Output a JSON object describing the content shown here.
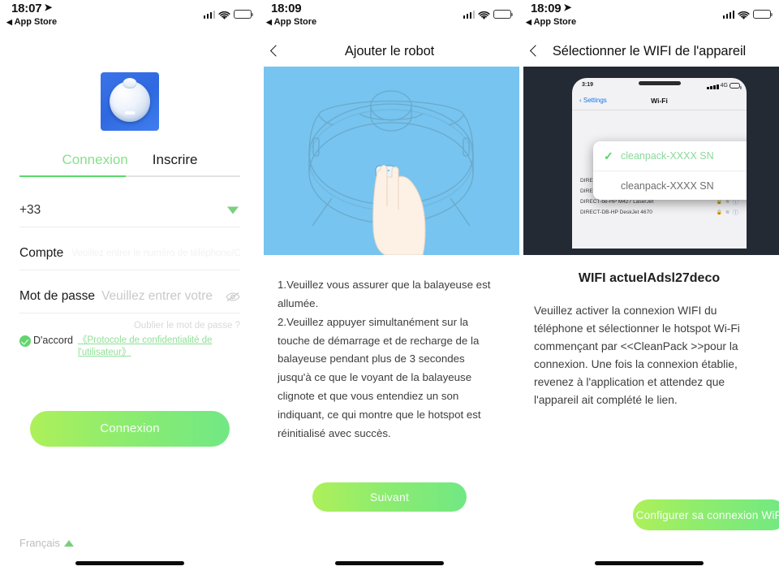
{
  "screens": [
    {
      "status": {
        "time": "18:07",
        "location_icon": "location-arrow-icon",
        "back_label": "App Store",
        "signal": "signal-bars-icon",
        "wifi": "wifi-icon",
        "battery": "battery-icon"
      },
      "logo": {
        "name": "app-logo-robot-vacuum"
      },
      "tabs": [
        {
          "label": "Connexion",
          "active": true
        },
        {
          "label": "Inscrire",
          "active": false
        }
      ],
      "fields": {
        "country_code": {
          "value": "+33",
          "caret": "chevron-down-icon"
        },
        "account": {
          "label": "Compte",
          "placeholder": "Veuillez entrer le numéro de téléphone/Courriel"
        },
        "password": {
          "label": "Mot de passe",
          "placeholder": "Veuillez entrer votre",
          "eye": "eye-off-icon"
        }
      },
      "forgot_label": "Oublier le mot de passe ?",
      "agree": {
        "checked": true,
        "label": "D'accord",
        "link": "《Protocole de confidentialité de l'utilisateur》"
      },
      "submit_label": "Connexion",
      "language": {
        "label": "Français",
        "caret": "chevron-up-icon"
      }
    },
    {
      "status": {
        "time": "18:09",
        "back_label": "App Store"
      },
      "nav": {
        "back": "chevron-left-icon",
        "title": "Ajouter le robot"
      },
      "hero": {
        "name": "robot-vacuum-press-button-illustration",
        "bg": "#76c4ef"
      },
      "instructions": "1.Veuillez vous assurer que la balayeuse est allumée.\n2.Veuillez appuyer simultanément sur la touche de démarrage et de recharge de la balayeuse pendant plus de 3 secondes jusqu'à ce que le voyant de la balayeuse clignote et que vous entendiez un son indiquant, ce qui montre que le hotspot est réinitialisé avec succès.",
      "button_label": "Suivant"
    },
    {
      "status": {
        "time": "18:09",
        "location_icon": "location-arrow-icon",
        "back_label": "App Store"
      },
      "nav": {
        "back": "chevron-left-icon",
        "title": "Sélectionner le WIFI de l'appareil"
      },
      "hero": {
        "name": "iphone-wifi-settings-screenshot",
        "bg": "#242a33",
        "phone": {
          "time": "3:19",
          "carrier": "4G",
          "back_label": "Settings",
          "title": "Wi-Fi",
          "popup_rows": [
            {
              "name": "cleanpack-XXXX SN",
              "selected": true,
              "check": "check-icon",
              "wifi": "wifi-icon",
              "info": "info-icon"
            },
            {
              "name": "cleanpack-XXXX SN",
              "selected": false,
              "wifi": "wifi-icon",
              "info": "info-icon"
            }
          ],
          "list_rows": [
            "DIRECT-be-HP M427 LaserJet",
            "DIRECT-be-HP M427 LaserJet",
            "DIRECT-be-HP M427 LaserJet",
            "DIRECT-DB-HP DeskJet 4670"
          ]
        }
      },
      "current_wifi": "WIFI actuelAdsl27deco",
      "paragraph": "Veuillez activer la connexion WIFI du téléphone et sélectionner le hotspot Wi-Fi commençant par <<CleanPack >>pour la connexion. Une fois la connexion établie, revenez à l'application et attendez que l'appareil ait complété le lien.",
      "button_label": "Configurer sa connexion WiFi"
    }
  ],
  "colors": {
    "accent_green": "#5bd96a",
    "button_gradient_start": "#aef05a",
    "button_gradient_end": "#71e884",
    "hero_blue": "#76c4ef",
    "hero_dark": "#242a33"
  }
}
